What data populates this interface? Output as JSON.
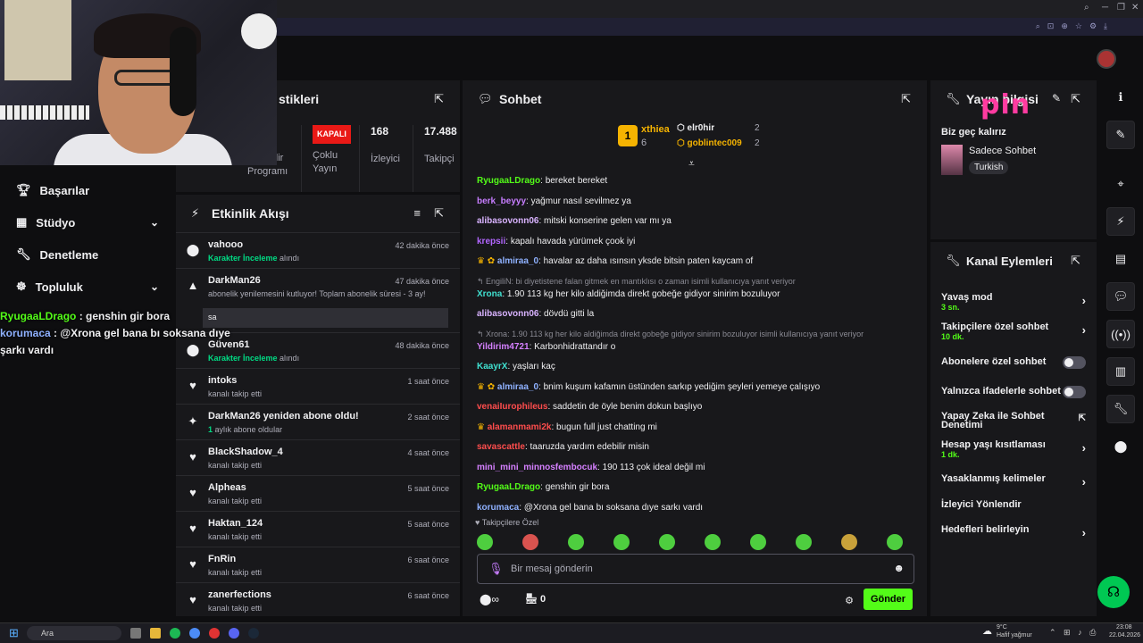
{
  "browser": {
    "icons": [
      "🔍",
      "⊡",
      "⊕",
      "☆",
      "⚙",
      "AI"
    ]
  },
  "sidebar": {
    "items": [
      {
        "label": "Başarılar",
        "icon": "trophy-icon"
      },
      {
        "label": "Stüdyo",
        "icon": "studio-icon",
        "chevron": "⌄"
      },
      {
        "label": "Denetleme",
        "icon": "wrench-icon"
      },
      {
        "label": "Topluluk",
        "icon": "community-icon",
        "chevron": "⌄"
      }
    ]
  },
  "overlay_chat": [
    {
      "user": "RyugaaLDrago",
      "sep": " : ",
      "text": "genshin gir bora",
      "color": "#53fc18"
    },
    {
      "user": "korumaca",
      "sep": " : ",
      "text": "@Xrona gel bana bı soksana dıye şarkı vardı",
      "color": "#8fb1ff"
    }
  ],
  "stats": {
    "title": "stikleri",
    "items": [
      {
        "value": "",
        "label": "rlik Gelir Programı"
      },
      {
        "badge": "KAPALI",
        "label": "Çoklu Yayın"
      },
      {
        "value": "168",
        "label": "İzleyici"
      },
      {
        "value": "17.488",
        "label": "Takipçi"
      }
    ]
  },
  "activity": {
    "title": "Etkinlik Akışı",
    "items": [
      {
        "name": "vahooo",
        "sub_hl": "Karakter İnceleme",
        "sub": " alındı",
        "time": "42 dakika önce",
        "icon": "⬤"
      },
      {
        "name": "DarkMan26",
        "sub": "abonelik yenilemesini kutluyor! Toplam abonelik süresi - 3 ay!",
        "reply": "sa",
        "time": "47 dakika önce",
        "icon": "▲"
      },
      {
        "name": "Güven61",
        "sub_hl": "Karakter İnceleme",
        "sub": " alındı",
        "time": "48 dakika önce",
        "icon": "⬤"
      },
      {
        "name": "intoks",
        "sub": "kanalı takip etti",
        "time": "1 saat önce",
        "icon": "♥"
      },
      {
        "name": "DarkMan26 yeniden abone oldu!",
        "sub_hl": "1",
        "sub": " aylık abone oldular",
        "time": "2 saat önce",
        "icon": "✦"
      },
      {
        "name": "BlackShadow_4",
        "sub": "kanalı takip etti",
        "time": "4 saat önce",
        "icon": "♥"
      },
      {
        "name": "Alpheas",
        "sub": "kanalı takip etti",
        "time": "5 saat önce",
        "icon": "♥"
      },
      {
        "name": "Haktan_124",
        "sub": "kanalı takip etti",
        "time": "5 saat önce",
        "icon": "♥"
      },
      {
        "name": "FnRin",
        "sub": "kanalı takip etti",
        "time": "6 saat önce",
        "icon": "♥"
      },
      {
        "name": "zanerfections",
        "sub": "kanalı takip etti",
        "time": "6 saat önce",
        "icon": "♥"
      }
    ]
  },
  "chat": {
    "title": "Sohbet",
    "leaderboard": [
      {
        "rank": "1",
        "name": "xthiea",
        "count": "6"
      },
      {
        "rank": "2",
        "name": "elr0hir",
        "count": "2"
      },
      {
        "rank": "3",
        "name": "goblintec009",
        "count": "2"
      }
    ],
    "messages": [
      {
        "user": "RyugaaLDrago",
        "color": "#53fc18",
        "text": "bereket bereket"
      },
      {
        "user": "berk_beyyy",
        "color": "#c77dff",
        "text": "yağmur nasıl sevilmez ya"
      },
      {
        "user": "alibasovonn06",
        "color": "#d9b3ff",
        "text": "mitski konserine gelen var mı ya"
      },
      {
        "user": "krepsii",
        "color": "#b266ff",
        "text": "kapalı havada yürümek çook iyi"
      },
      {
        "user": "almiraa_0",
        "color": "#8fb1ff",
        "text": "havalar az daha ısınsın yksde bitsin paten kaycam of",
        "badges": true
      },
      {
        "reply": "EngiliN: bi diyetistene falan gitmek en mantıklısı o zaman isimli kullanıcıya yanıt veriyor"
      },
      {
        "user": "Xrona",
        "color": "#40e0d0",
        "text": "1.90 113 kg her kilo aldiğimda direkt gobeğe gidiyor sinirim bozuluyor"
      },
      {
        "user": "alibasovonn06",
        "color": "#d9b3ff",
        "text": "dövdü gitti la"
      },
      {
        "reply": "Xrona: 1.90 113 kg her kilo aldiğimda direkt gobeğe gidiyor sinirim bozuluyor isimli kullanıcıya yanıt veriyor"
      },
      {
        "user": "Yildirim4721",
        "color": "#d580ff",
        "text": "Karbonhidrattandır o"
      },
      {
        "user": "KaayrX",
        "color": "#40e0d0",
        "text": "yaşları kaç"
      },
      {
        "user": "almiraa_0",
        "color": "#8fb1ff",
        "text": "bnim kuşum kafamın üstünden sarkıp yediğim şeyleri yemeye çalışıyo",
        "badges": true
      },
      {
        "user": "venaiIurophileus",
        "color": "#ff4d4d",
        "text": "saddetin de öyle benim dokun başlıyo"
      },
      {
        "user": "alamanmami2k",
        "color": "#ff4d4d",
        "text": "bugun full just chatting mi",
        "crown": true
      },
      {
        "user": "savascattle",
        "color": "#ff4d4d",
        "text": "taaruzda yardım edebilir misin"
      },
      {
        "user": "mini_mini_minnosfembocuk",
        "color": "#d580ff",
        "text": "190 113 çok ideal değil mi"
      },
      {
        "user": "RyugaaLDrago",
        "color": "#53fc18",
        "text": "genshin gir bora"
      },
      {
        "user": "korumaca",
        "color": "#8fb1ff",
        "text": "@Xrona gel bana bı soksana dıye sarkı vardı"
      }
    ],
    "followers_only": "Takipçilere Özel",
    "input_placeholder": "Bir mesaj gönderin",
    "points": "0",
    "send": "Gönder"
  },
  "stream_info": {
    "title": "Yayın bilgisi",
    "stream_title": "Biz geç kalırız",
    "category": "Sadece Sohbet",
    "language": "Turkish"
  },
  "logo": "pin",
  "channel_actions": {
    "title": "Kanal Eylemleri",
    "items": [
      {
        "label": "Yavaş mod",
        "sub": "3 sn.",
        "type": "arrow"
      },
      {
        "label": "Takipçilere özel sohbet",
        "sub": "10 dk.",
        "type": "arrow"
      },
      {
        "label": "Abonelere özel sohbet",
        "type": "toggle"
      },
      {
        "label": "Yalnızca ifadelerle sohbet",
        "type": "toggle"
      },
      {
        "label": "Yapay Zeka ile Sohbet Denetimi",
        "type": "external"
      },
      {
        "label": "Hesap yaşı kısıtlaması",
        "sub": "1 dk.",
        "type": "arrow"
      },
      {
        "label": "Yasaklanmış kelimeler",
        "type": "arrow"
      },
      {
        "label": "İzleyici Yönlendir",
        "type": "none"
      },
      {
        "label": "Hedefleri belirleyin",
        "type": "arrow"
      }
    ]
  },
  "taskbar": {
    "search": "Ara",
    "weather": "9°C",
    "weather_sub": "Hafif yağmur",
    "time": "23:08",
    "date": "22.04.2026"
  }
}
